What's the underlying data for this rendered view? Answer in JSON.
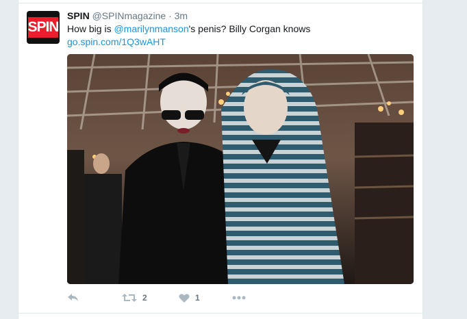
{
  "tweet": {
    "name": "SPIN",
    "handle": "@SPINmagazine",
    "dot": "·",
    "time": "3m",
    "avatar_text": "SPIN",
    "text_before": "How big is ",
    "mention": "@marilynmanson",
    "text_after": "'s penis? Billy Corgan knows",
    "link": "go.spin.com/1Q3wAHT",
    "media_icon": "photo",
    "actions": {
      "reply_icon": "reply-icon",
      "retweet_icon": "retweet-icon",
      "retweet_count": "2",
      "like_icon": "heart-icon",
      "like_count": "1",
      "more_icon": "more-icon"
    }
  },
  "colors": {
    "link": "#1b95e0",
    "brand_red": "#e8202e",
    "muted": "#657786",
    "icon": "#aab8c2"
  }
}
